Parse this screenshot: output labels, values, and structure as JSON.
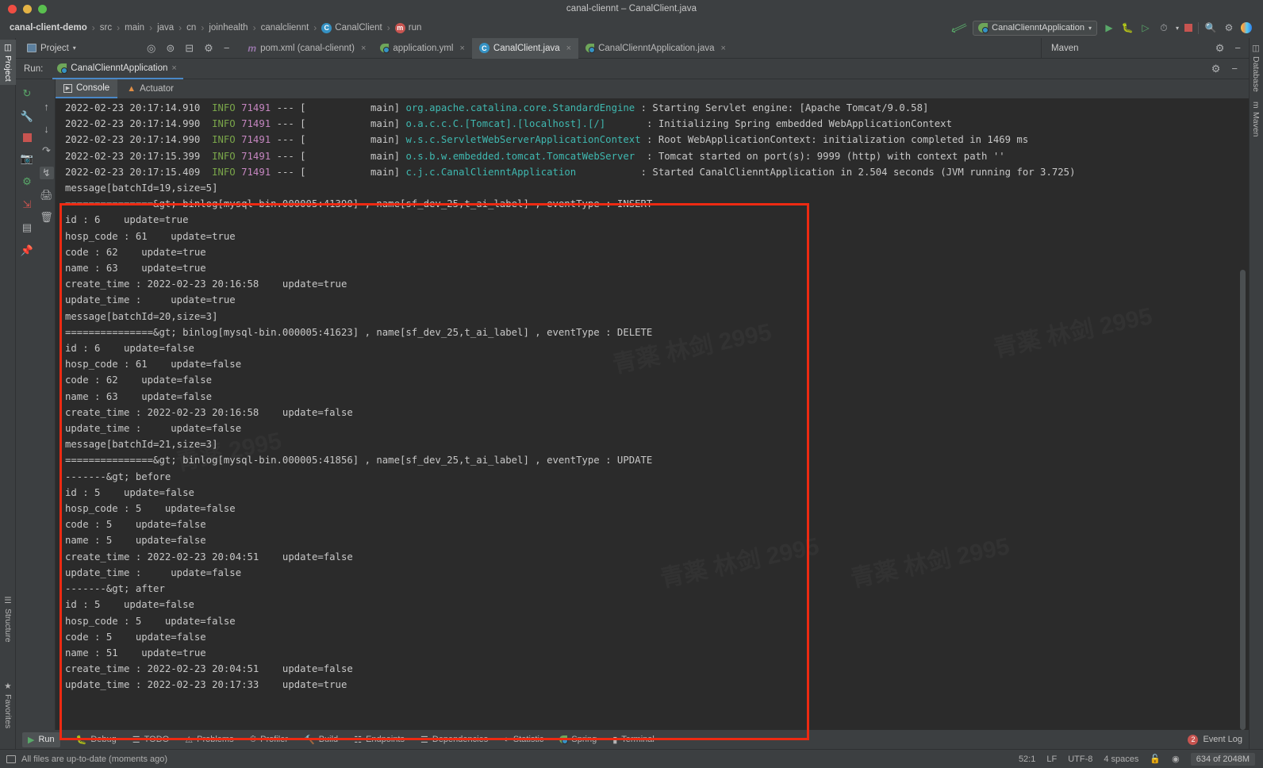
{
  "window": {
    "title": "canal-cliennt – CanalClient.java",
    "traffic_lights": [
      "close",
      "minimize",
      "maximize"
    ]
  },
  "breadcrumb": {
    "items": [
      {
        "label": "canal-client-demo",
        "icon": ""
      },
      {
        "label": "src",
        "icon": ""
      },
      {
        "label": "main",
        "icon": ""
      },
      {
        "label": "java",
        "icon": ""
      },
      {
        "label": "cn",
        "icon": ""
      },
      {
        "label": "joinhealth",
        "icon": ""
      },
      {
        "label": "canalcliennt",
        "icon": ""
      },
      {
        "label": "CanalClient",
        "icon": "class-icon"
      },
      {
        "label": "run",
        "icon": "method-icon"
      }
    ],
    "separator": "›"
  },
  "nav_right": {
    "back_icon": "arrow-back-icon",
    "run_config": {
      "label": "CanalClienntApplication",
      "caret": "▾"
    },
    "buttons": [
      {
        "name": "run-button",
        "glyph": "▷"
      },
      {
        "name": "debug-button",
        "glyph": "⚙"
      },
      {
        "name": "run-with-coverage-button",
        "glyph": "▶"
      },
      {
        "name": "profiler-button",
        "glyph": "◔"
      },
      {
        "name": "stop-button",
        "glyph": "■"
      },
      {
        "name": "search-everywhere-button",
        "glyph": "⌕"
      },
      {
        "name": "settings-button",
        "glyph": "⚙"
      }
    ]
  },
  "left_stripe": {
    "tabs": [
      {
        "label": "Project",
        "selected": true
      },
      {
        "label": "Structure",
        "selected": false
      },
      {
        "label": "Favorites",
        "selected": false
      }
    ]
  },
  "right_stripe": {
    "tabs": [
      {
        "label": "Database",
        "selected": false
      },
      {
        "label": "Maven",
        "selected": false
      }
    ]
  },
  "project_toolbar": {
    "title": "Project",
    "caret": "▾",
    "icons": [
      "locate-icon",
      "expand-all-icon",
      "collapse-all-icon",
      "gear-icon",
      "hide-icon"
    ]
  },
  "editor_tabs": [
    {
      "label": "pom.xml (canal-cliennt)",
      "icon": "maven-icon",
      "active": false,
      "close": "×"
    },
    {
      "label": "application.yml",
      "icon": "spring-icon",
      "active": false,
      "close": "×"
    },
    {
      "label": "CanalClient.java",
      "icon": "class-icon",
      "active": true,
      "close": "×"
    },
    {
      "label": "CanalClienntApplication.java",
      "icon": "spring-class-icon",
      "active": false,
      "close": "×"
    }
  ],
  "maven_panel": {
    "title": "Maven",
    "icons": [
      "gear-icon",
      "hide-icon"
    ]
  },
  "run_window": {
    "label": "Run:",
    "tab": {
      "label": "CanalClienntApplication",
      "icon": "spring-boot-icon",
      "close": "×"
    },
    "right_icons": [
      "gear-icon",
      "hide-icon"
    ],
    "console_tabs": [
      {
        "label": "Console",
        "icon": "console-icon",
        "active": true
      },
      {
        "label": "Actuator",
        "icon": "actuator-icon",
        "active": false
      }
    ],
    "side_icons_a": [
      "rerun-icon",
      "wrench-icon",
      "stop-icon",
      "camera-icon",
      "thread-dump-icon",
      "export-icon",
      "layout-icon",
      "pin-icon"
    ],
    "side_icons_b": [
      "up-icon",
      "down-icon",
      "soft-wrap-icon",
      "scroll-to-end-icon",
      "print-icon",
      "trash-icon"
    ]
  },
  "console": {
    "log_lines": [
      {
        "time": "2022-02-23 20:17:14.910",
        "level": "INFO",
        "pid": "71491",
        "sep": "--- [",
        "thread": "           main]",
        "logger": "org.apache.catalina.core.StandardEngine",
        "logger_pad": "",
        "msg": ": Starting Servlet engine: [Apache Tomcat/9.0.58]"
      },
      {
        "time": "2022-02-23 20:17:14.990",
        "level": "INFO",
        "pid": "71491",
        "sep": "--- [",
        "thread": "           main]",
        "logger": "o.a.c.c.C.[Tomcat].[localhost].[/]",
        "logger_pad": "      ",
        "msg": ": Initializing Spring embedded WebApplicationContext"
      },
      {
        "time": "2022-02-23 20:17:14.990",
        "level": "INFO",
        "pid": "71491",
        "sep": "--- [",
        "thread": "           main]",
        "logger": "w.s.c.ServletWebServerApplicationContext",
        "logger_pad": "",
        "msg": ": Root WebApplicationContext: initialization completed in 1469 ms"
      },
      {
        "time": "2022-02-23 20:17:15.399",
        "level": "INFO",
        "pid": "71491",
        "sep": "--- [",
        "thread": "           main]",
        "logger": "o.s.b.w.embedded.tomcat.TomcatWebServer",
        "logger_pad": " ",
        "msg": ": Tomcat started on port(s): 9999 (http) with context path ''"
      },
      {
        "time": "2022-02-23 20:17:15.409",
        "level": "INFO",
        "pid": "71491",
        "sep": "--- [",
        "thread": "           main]",
        "logger": "c.j.c.CanalClienntApplication",
        "logger_pad": "          ",
        "msg": ": Started CanalClienntApplication in 2.504 seconds (JVM running for 3.725)"
      }
    ],
    "output_lines": [
      "message[batchId=19,size=5]",
      "===============&gt; binlog[mysql-bin.000005:41390] , name[sf_dev_25,t_ai_label] , eventType : INSERT",
      "id : 6    update=true",
      "hosp_code : 61    update=true",
      "code : 62    update=true",
      "name : 63    update=true",
      "create_time : 2022-02-23 20:16:58    update=true",
      "update_time :     update=true",
      "message[batchId=20,size=3]",
      "===============&gt; binlog[mysql-bin.000005:41623] , name[sf_dev_25,t_ai_label] , eventType : DELETE",
      "id : 6    update=false",
      "hosp_code : 61    update=false",
      "code : 62    update=false",
      "name : 63    update=false",
      "create_time : 2022-02-23 20:16:58    update=false",
      "update_time :     update=false",
      "message[batchId=21,size=3]",
      "===============&gt; binlog[mysql-bin.000005:41856] , name[sf_dev_25,t_ai_label] , eventType : UPDATE",
      "-------&gt; before",
      "id : 5    update=false",
      "hosp_code : 5    update=false",
      "code : 5    update=false",
      "name : 5    update=false",
      "create_time : 2022-02-23 20:04:51    update=false",
      "update_time :     update=false",
      "-------&gt; after",
      "id : 5    update=false",
      "hosp_code : 5    update=false",
      "code : 5    update=false",
      "name : 51    update=true",
      "create_time : 2022-02-23 20:04:51    update=false",
      "update_time : 2022-02-23 20:17:33    update=true",
      "|"
    ]
  },
  "annotation": {
    "box_color": "#ed2a12",
    "description": "red-highlight-rectangle"
  },
  "bottom_bar": {
    "items": [
      {
        "label": "Run",
        "icon": "run-icon",
        "selected": true
      },
      {
        "label": "Debug",
        "icon": "debug-icon",
        "selected": false
      },
      {
        "label": "TODO",
        "icon": "todo-icon",
        "selected": false
      },
      {
        "label": "Problems",
        "icon": "problems-icon",
        "selected": false
      },
      {
        "label": "Profiler",
        "icon": "profiler-icon",
        "selected": false
      },
      {
        "label": "Build",
        "icon": "build-icon",
        "selected": false
      },
      {
        "label": "Endpoints",
        "icon": "endpoints-icon",
        "selected": false
      },
      {
        "label": "Dependencies",
        "icon": "dependencies-icon",
        "selected": false
      },
      {
        "label": "Statistic",
        "icon": "statistic-icon",
        "selected": false
      },
      {
        "label": "Spring",
        "icon": "spring-icon",
        "selected": false
      },
      {
        "label": "Terminal",
        "icon": "terminal-icon",
        "selected": false
      }
    ],
    "event_log": {
      "label": "Event Log",
      "badge": "2"
    }
  },
  "status_bar": {
    "message": "All files are up-to-date (moments ago)",
    "caret_position": "52:1",
    "line_separator": "LF",
    "encoding": "UTF-8",
    "indent": "4 spaces",
    "lock_icon": "unlocked-icon",
    "inspection_icon": "inspection-icon",
    "memory": "634 of 2048M"
  },
  "colors": {
    "accent_blue": "#4a88c7",
    "console_bg": "#2b2b2b",
    "chrome_bg": "#3c3f41",
    "annotation_red": "#ed2a12",
    "log_info": "#7aa64a",
    "log_pid": "#c586c0",
    "log_logger": "#3fb8b0"
  }
}
